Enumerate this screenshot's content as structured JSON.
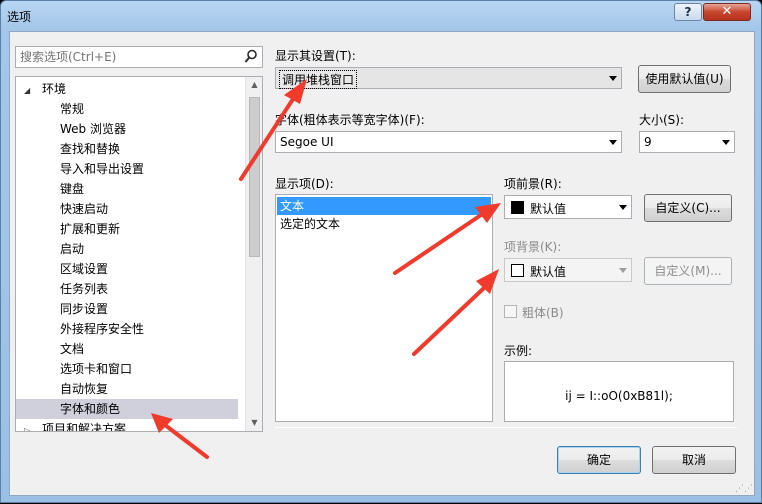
{
  "window": {
    "title": "选项",
    "help_label": "?",
    "close_label": "✕"
  },
  "search": {
    "placeholder": "搜索选项(Ctrl+E)"
  },
  "tree": {
    "root": {
      "label": "环境",
      "expander": "◢"
    },
    "items": [
      {
        "label": "常规"
      },
      {
        "label": "Web 浏览器"
      },
      {
        "label": "查找和替换"
      },
      {
        "label": "导入和导出设置"
      },
      {
        "label": "键盘"
      },
      {
        "label": "快速启动"
      },
      {
        "label": "扩展和更新"
      },
      {
        "label": "启动"
      },
      {
        "label": "区域设置"
      },
      {
        "label": "任务列表"
      },
      {
        "label": "同步设置"
      },
      {
        "label": "外接程序安全性"
      },
      {
        "label": "文档"
      },
      {
        "label": "选项卡和窗口"
      },
      {
        "label": "自动恢复"
      },
      {
        "label": "字体和颜色",
        "selected": true
      }
    ],
    "next_root": {
      "label": "项目和解决方案",
      "expander": "▷"
    }
  },
  "show_settings": {
    "label": "显示其设置(T):",
    "value": "调用堆栈窗口",
    "use_defaults_button": "使用默认值(U)"
  },
  "font": {
    "label": "字体(粗体表示等宽字体)(F):",
    "value": "Segoe UI"
  },
  "size": {
    "label": "大小(S):",
    "value": "9"
  },
  "display_items": {
    "label": "显示项(D):",
    "items": [
      "文本",
      "选定的文本"
    ],
    "selected_index": 0
  },
  "foreground": {
    "label": "项前景(R):",
    "value": "默认值",
    "swatch_color": "#000000",
    "custom_button": "自定义(C)..."
  },
  "background": {
    "label": "项背景(K):",
    "value": "默认值",
    "swatch_color": "#ffffff",
    "custom_button": "自定义(M)..."
  },
  "bold": {
    "label": "粗体(B)",
    "checked": false
  },
  "sample": {
    "label": "示例:",
    "text": "ij = I::oO(0xB81l);"
  },
  "footer": {
    "ok_button": "确定",
    "cancel_button": "取消"
  },
  "colors": {
    "annotation_arrow": "#f03a2c",
    "selection": "#3399ff",
    "tree_selection": "#cfd0db"
  }
}
